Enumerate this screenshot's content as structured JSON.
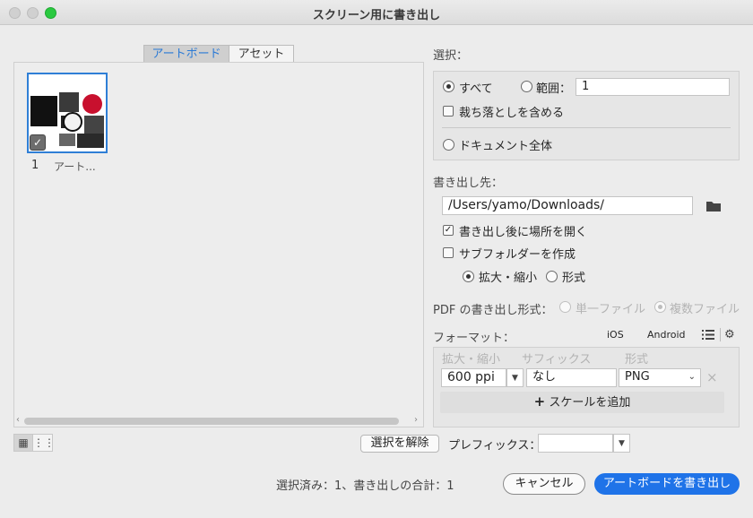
{
  "window": {
    "title": "スクリーン用に書き出し"
  },
  "tabs": {
    "artboard": "アートボード",
    "assets": "アセット"
  },
  "artboard": {
    "number": "1",
    "name": "アート..."
  },
  "selection": {
    "label": "選択：",
    "all": "すべて",
    "range": "範囲：",
    "range_value": "1",
    "include_bleed": "裁ち落としを含める",
    "whole_document": "ドキュメント全体"
  },
  "export_to": {
    "label": "書き出し先：",
    "path": "/Users/yamo/Downloads/",
    "open_location": "書き出し後に場所を開く",
    "create_subfolders": "サブフォルダーを作成",
    "scale": "拡大・縮小",
    "format": "形式"
  },
  "pdf": {
    "label": "PDF の書き出し形式：",
    "single": "単一ファイル",
    "multiple": "複数ファイル"
  },
  "formats": {
    "label": "フォーマット：",
    "ios": "iOS",
    "android": "Android",
    "col_scale": "拡大・縮小",
    "col_suffix": "サフィックス",
    "col_format": "形式",
    "scale_value": "600 ppi",
    "suffix_value": "なし",
    "format_value": "PNG",
    "remove": "×",
    "add_scale": "スケールを追加"
  },
  "bottom": {
    "deselect": "選択を解除",
    "prefix_label": "プレフィックス：",
    "prefix_value": "",
    "summary": "選択済み：1、書き出しの合計：1",
    "cancel": "キャンセル",
    "export": "アートボードを書き出し"
  },
  "icons": {
    "folder": "folder-icon",
    "list": "list-icon",
    "settings": "gear-icon",
    "grid": "grid-view-icon",
    "list_view": "list-view-icon"
  },
  "colors": {
    "accent": "#1f73e8",
    "tab_active_text": "#2a7ad6"
  }
}
